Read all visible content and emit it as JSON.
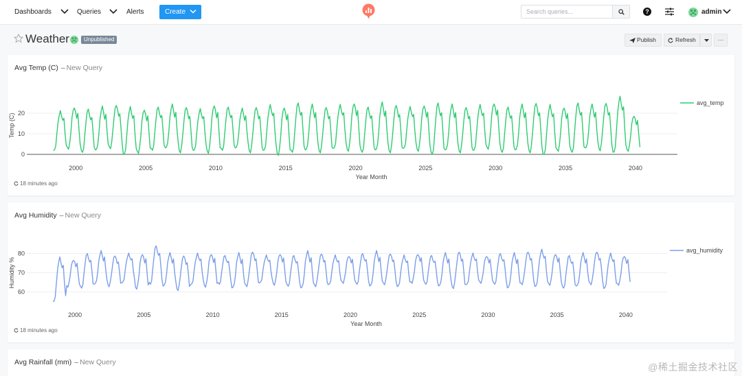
{
  "nav": {
    "dashboards": "Dashboards",
    "queries": "Queries",
    "alerts": "Alerts",
    "create": "Create",
    "search_placeholder": "Search queries...",
    "user": "admin"
  },
  "page": {
    "title": "Weather",
    "status": "Unpublished",
    "publish": "Publish",
    "refresh": "Refresh",
    "more": "···"
  },
  "colors": {
    "accent": "#2196f3",
    "temp": "#2ecc71",
    "humidity": "#7b9ee8",
    "badge": "#778898"
  },
  "widgets": [
    {
      "title": "Avg Temp (C)",
      "sep": "–",
      "subtitle": "New Query",
      "updated": "18 minutes ago"
    },
    {
      "title": "Avg Humidity",
      "sep": "–",
      "subtitle": "New Query",
      "updated": "18 minutes ago"
    },
    {
      "title": "Avg Rainfall (mm)",
      "sep": "–",
      "subtitle": "New Query"
    }
  ],
  "watermark": "@稀土掘金技术社区",
  "chart_data": [
    {
      "type": "line",
      "xlabel": "Year Month",
      "ylabel": "Temp (C)",
      "x_range": [
        1996.5,
        2043
      ],
      "ylim": [
        -2,
        30
      ],
      "x_ticks": [
        2000,
        2005,
        2010,
        2015,
        2020,
        2025,
        2030,
        2035,
        2040
      ],
      "y_ticks": [
        0,
        10,
        20
      ],
      "legend": "right",
      "x_start": 1998.4,
      "x_end": 2040.4,
      "series": [
        {
          "name": "avg_temp",
          "color": "#2ecc71",
          "peaks": [
            21,
            23,
            22,
            23,
            24,
            23,
            22,
            23,
            24,
            23,
            22,
            24,
            23,
            22,
            23,
            24,
            23,
            25,
            24,
            23,
            24,
            25,
            23,
            25,
            24,
            23,
            24,
            25,
            24,
            23,
            24,
            25,
            23,
            24,
            25,
            24,
            23,
            25,
            24,
            25,
            28,
            19
          ],
          "troughs": [
            2,
            3,
            1,
            2,
            3,
            0,
            1,
            2,
            3,
            1,
            2,
            1,
            2,
            3,
            1,
            2,
            0,
            1,
            2,
            1,
            3,
            2,
            1,
            2,
            1,
            3,
            2,
            0,
            2,
            1,
            2,
            3,
            1,
            2,
            1,
            0,
            2,
            1,
            3,
            2,
            1,
            2
          ]
        }
      ]
    },
    {
      "type": "line",
      "xlabel": "Year Month",
      "ylabel": "Humidity %",
      "x_range": [
        1996.5,
        2043
      ],
      "ylim": [
        53,
        87
      ],
      "x_ticks": [
        2000,
        2005,
        2010,
        2015,
        2020,
        2025,
        2030,
        2035,
        2040
      ],
      "y_ticks": [
        60,
        70,
        80
      ],
      "legend": "right",
      "x_start": 1998.4,
      "x_end": 2040.4,
      "series": [
        {
          "name": "avg_humidity",
          "color": "#7b9ee8",
          "peaks": [
            78,
            77,
            80,
            81,
            79,
            80,
            80,
            84,
            80,
            79,
            80,
            80,
            79,
            80,
            81,
            79,
            80,
            79,
            81,
            80,
            79,
            79,
            80,
            81,
            80,
            79,
            80,
            79,
            80,
            81,
            80,
            79,
            80,
            80,
            81,
            82,
            80,
            79,
            80,
            81,
            80,
            79
          ],
          "troughs": [
            55,
            63,
            62,
            64,
            63,
            65,
            62,
            64,
            63,
            61,
            64,
            63,
            64,
            62,
            63,
            65,
            64,
            63,
            62,
            63,
            64,
            65,
            64,
            63,
            64,
            63,
            65,
            64,
            63,
            62,
            64,
            65,
            64,
            62,
            64,
            63,
            64,
            62,
            63,
            64,
            62,
            64
          ]
        }
      ]
    }
  ]
}
